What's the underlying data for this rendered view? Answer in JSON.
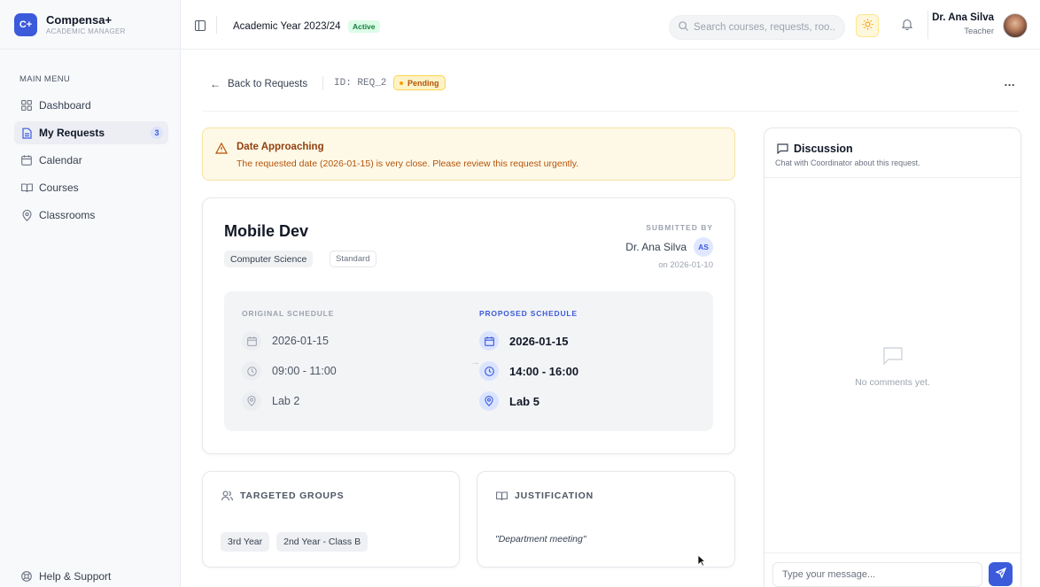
{
  "brand": {
    "logo": "C+",
    "name": "Compensa+",
    "subtitle": "ACADEMIC MANAGER"
  },
  "sidebar": {
    "section_label": "MAIN MENU",
    "items": [
      {
        "label": "Dashboard",
        "icon": "dashboard-icon"
      },
      {
        "label": "My Requests",
        "icon": "document-icon",
        "badge": "3",
        "active": true
      },
      {
        "label": "Calendar",
        "icon": "calendar-icon"
      },
      {
        "label": "Courses",
        "icon": "book-icon"
      },
      {
        "label": "Classrooms",
        "icon": "location-icon"
      }
    ],
    "help_label": "Help & Support"
  },
  "topbar": {
    "academic_year": "Academic Year 2023/24",
    "year_status": "Active",
    "search_placeholder": "Search courses, requests, roo...",
    "user": {
      "name": "Dr. Ana Silva",
      "role": "Teacher"
    }
  },
  "breadcrumb": {
    "back_label": "Back to Requests",
    "request_id": "ID: REQ_2",
    "status": "Pending",
    "more_label": "..."
  },
  "alert": {
    "title": "Date Approaching",
    "message": "The requested date (2026-01-15) is very close. Please review this request urgently."
  },
  "request": {
    "course": "Mobile Dev",
    "department": "Computer Science",
    "type": "Standard",
    "submitted_label": "SUBMITTED BY",
    "submitter": "Dr. Ana Silva",
    "submitter_initials": "AS",
    "submitted_date": "on 2026-01-10",
    "original": {
      "label": "ORIGINAL SCHEDULE",
      "date": "2026-01-15",
      "time": "09:00 - 11:00",
      "room": "Lab 2"
    },
    "proposed": {
      "label": "PROPOSED SCHEDULE",
      "date": "2026-01-15",
      "time": "14:00 - 16:00",
      "room": "Lab 5"
    }
  },
  "groups": {
    "title": "TARGETED GROUPS",
    "items": [
      "3rd Year",
      "2nd Year - Class B"
    ]
  },
  "justification": {
    "title": "JUSTIFICATION",
    "text": "\"Department meeting\""
  },
  "discussion": {
    "title": "Discussion",
    "subtitle": "Chat with Coordinator about this request.",
    "empty_text": "No comments yet.",
    "input_placeholder": "Type your message..."
  },
  "colors": {
    "accent": "#3b5bdb",
    "warning": "#b45309",
    "success": "#15803d"
  }
}
